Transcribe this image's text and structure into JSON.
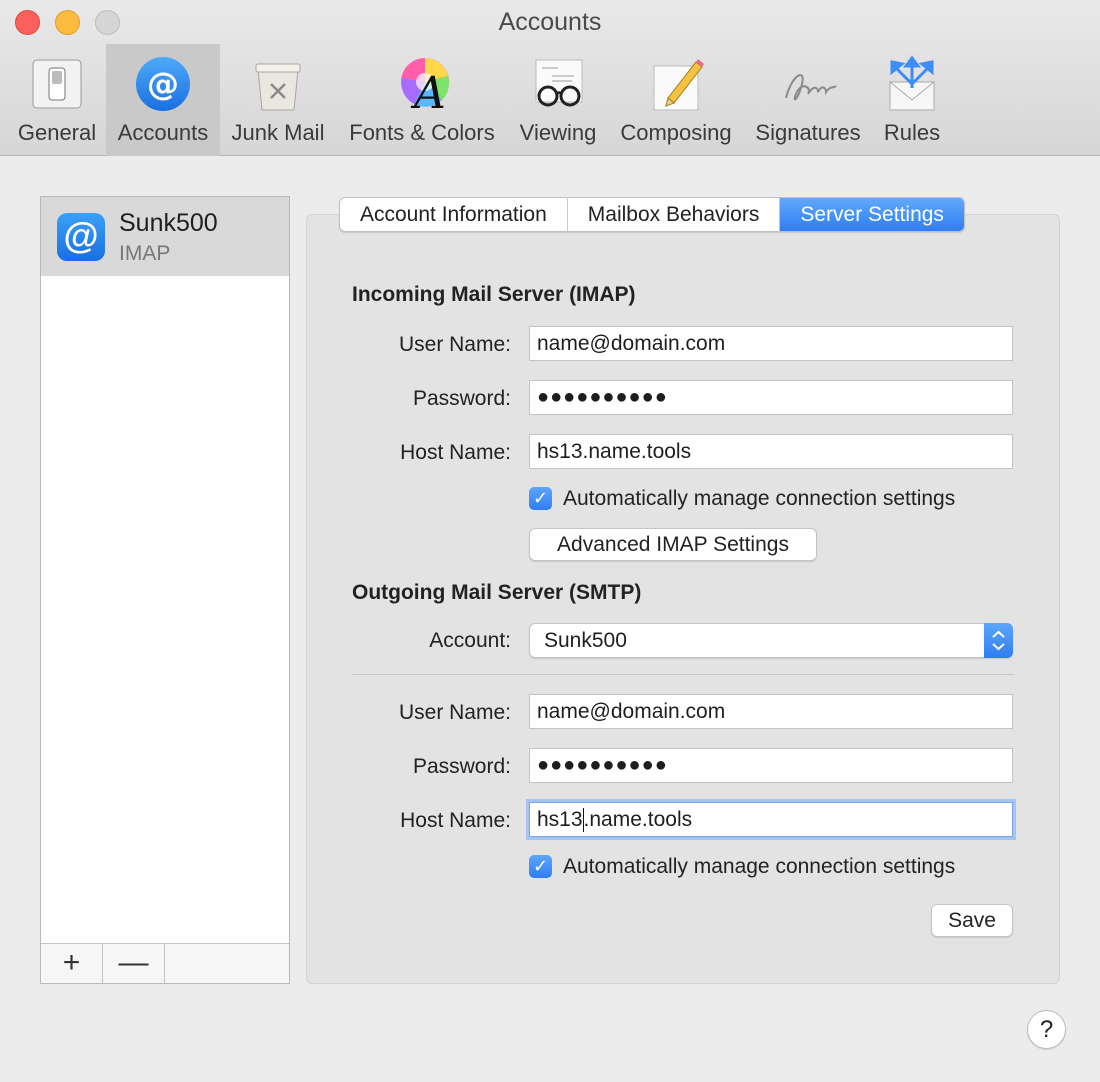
{
  "window": {
    "title": "Accounts"
  },
  "toolbar": {
    "items": [
      {
        "label": "General",
        "icon": "switch-icon"
      },
      {
        "label": "Accounts",
        "icon": "at-sign-icon",
        "selected": true
      },
      {
        "label": "Junk Mail",
        "icon": "trash-can-icon"
      },
      {
        "label": "Fonts & Colors",
        "icon": "color-wheel-icon"
      },
      {
        "label": "Viewing",
        "icon": "glasses-icon"
      },
      {
        "label": "Composing",
        "icon": "pencil-paper-icon"
      },
      {
        "label": "Signatures",
        "icon": "signature-icon"
      },
      {
        "label": "Rules",
        "icon": "envelope-arrows-icon"
      }
    ]
  },
  "accounts": {
    "list": [
      {
        "name": "Sunk500",
        "type": "IMAP",
        "icon": "at-sign-icon"
      }
    ],
    "add_label": "+",
    "remove_label": "—"
  },
  "tabs": [
    {
      "label": "Account Information"
    },
    {
      "label": "Mailbox Behaviors"
    },
    {
      "label": "Server Settings",
      "active": true
    }
  ],
  "incoming": {
    "title": "Incoming Mail Server (IMAP)",
    "user_label": "User Name:",
    "user_value": "name@domain.com",
    "password_label": "Password:",
    "password_value": "●●●●●●●●●●",
    "host_label": "Host Name:",
    "host_value": "hs13.name.tools",
    "auto_label": "Automatically manage connection settings",
    "auto_checked": true,
    "advanced_label": "Advanced IMAP Settings"
  },
  "outgoing": {
    "title": "Outgoing Mail Server (SMTP)",
    "account_label": "Account:",
    "account_value": "Sunk500",
    "user_label": "User Name:",
    "user_value": "name@domain.com",
    "password_label": "Password:",
    "password_value": "●●●●●●●●●●",
    "host_label": "Host Name:",
    "host_value_before_caret": "hs13",
    "host_value_after_caret": ".name.tools",
    "auto_label": "Automatically manage connection settings",
    "auto_checked": true
  },
  "buttons": {
    "save_label": "Save",
    "help_label": "?"
  },
  "colors": {
    "accent": "#2f7ef3",
    "close": "#fc605c",
    "minimize": "#fdbc40"
  }
}
